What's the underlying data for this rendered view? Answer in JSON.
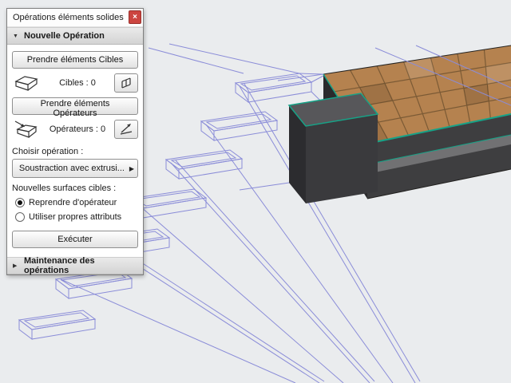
{
  "palette": {
    "title": "Opérations éléments solides",
    "close_glyph": "×",
    "glyphs": {
      "open": "▼",
      "closed": "▶",
      "flyout": "▶"
    },
    "sections": {
      "new_operation": "Nouvelle Opération",
      "maintenance": "Maintenance des opérations"
    },
    "buttons": {
      "get_targets": "Prendre éléments Cibles",
      "get_operators": "Prendre éléments Opérateurs",
      "execute": "Exécuter"
    },
    "counters": {
      "targets": "Cibles : 0",
      "operators": "Opérateurs : 0"
    },
    "labels": {
      "choose_operation": "Choisir opération :",
      "new_target_surfaces": "Nouvelles surfaces cibles :"
    },
    "operation_dropdown": "Soustraction avec extrusi...",
    "radios": [
      {
        "label": "Reprendre d'opérateur",
        "selected": true
      },
      {
        "label": "Utiliser propres attributs",
        "selected": false
      }
    ],
    "icons": {
      "close": "close-icon",
      "targets": "target-elements-cube-icon",
      "operators": "operator-elements-cube-icon",
      "highlight_targets": "highlight-targets-icon",
      "highlight_operators": "highlight-operators-icon"
    }
  },
  "scene": {
    "description": "3D viewport with blue wireframe stair steps and a solid tiled platform with a concrete step",
    "elements": [
      "wireframe-steps",
      "solid-platform",
      "front-step"
    ]
  },
  "colors": {
    "viewport_bg": "#eaecee",
    "wireframe": "#8a8cd8",
    "tile": "#b5824f",
    "grout": "#7b5a35",
    "slab": "#3e3e40",
    "slab_dark": "#2a2a2c",
    "strip": "#717173",
    "green": "#17a287",
    "step_top": "#57575a",
    "step_front": "#3a3a3d",
    "step_side": "#2c2c2f",
    "close_red": "#cc4540",
    "section_bg": "#d3d3d3",
    "accent_border": "#8f8f8f"
  }
}
